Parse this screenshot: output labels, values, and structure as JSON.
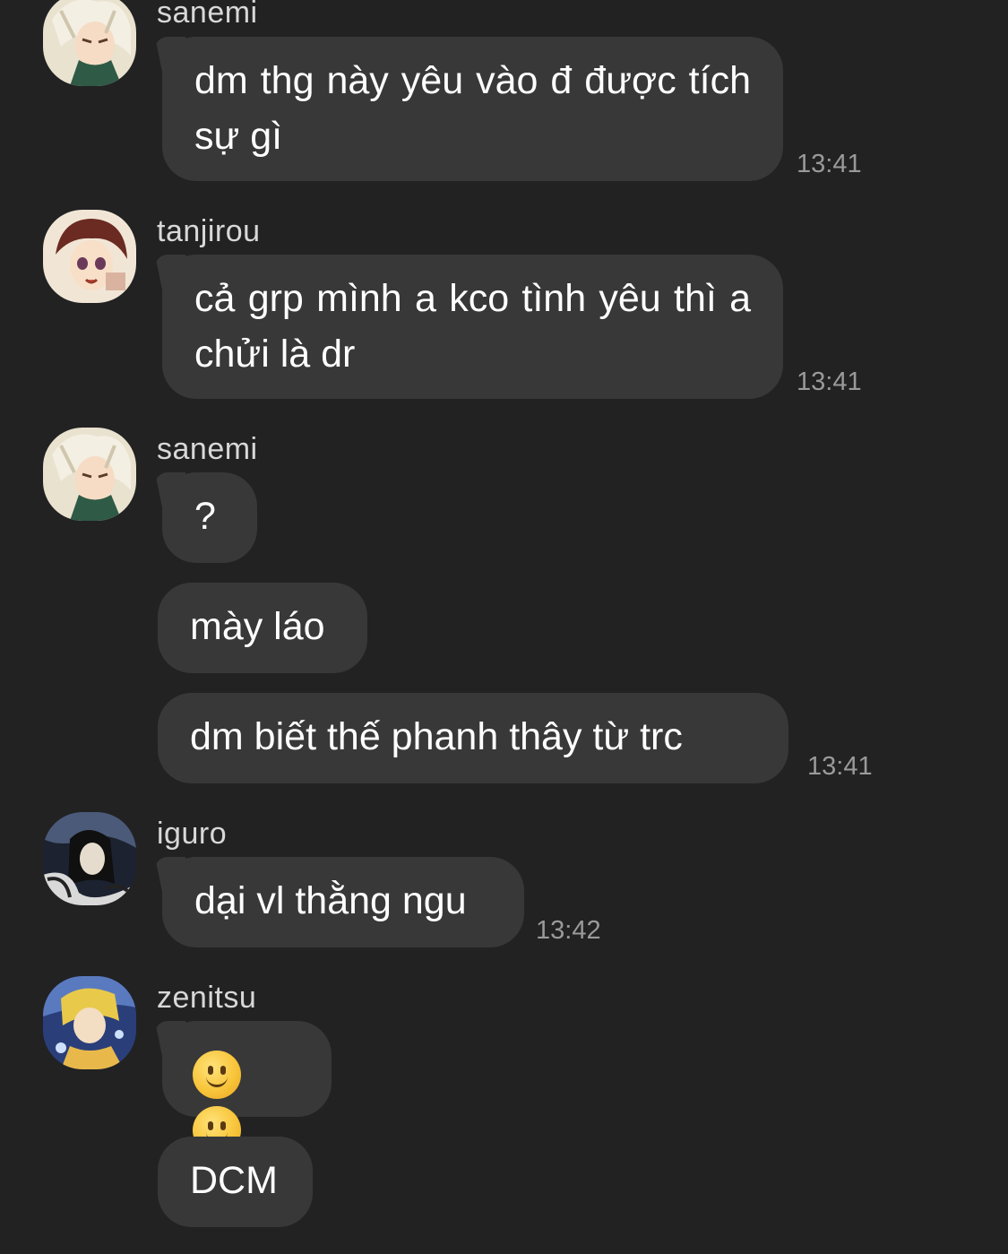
{
  "messages": [
    {
      "sender": "sanemi",
      "avatar": "sanemi-avatar",
      "bubbles": [
        {
          "text": "dm thg này yêu vào đ được tích sự gì"
        }
      ],
      "time": "13:41"
    },
    {
      "sender": "tanjirou",
      "avatar": "tanjirou-avatar",
      "bubbles": [
        {
          "text": "cả grp mình a kco tình yêu thì a chửi là dr"
        }
      ],
      "time": "13:41"
    },
    {
      "sender": "sanemi",
      "avatar": "sanemi-avatar",
      "bubbles": [
        {
          "text": "?"
        },
        {
          "text": "mày láo"
        },
        {
          "text": "dm biết thế phanh thây từ trc"
        }
      ],
      "time": "13:41"
    },
    {
      "sender": "iguro",
      "avatar": "iguro-avatar",
      "bubbles": [
        {
          "text": "dại vl thằng ngu"
        }
      ],
      "time": "13:42"
    },
    {
      "sender": "zenitsu",
      "avatar": "zenitsu-avatar",
      "bubbles": [
        {
          "emoji": [
            "slightly-smiling-face",
            "slightly-smiling-face"
          ]
        },
        {
          "text": "DCM"
        }
      ]
    }
  ],
  "colors": {
    "background": "#222223",
    "bubble": "#383839",
    "timestamp": "#9a9a9a"
  }
}
